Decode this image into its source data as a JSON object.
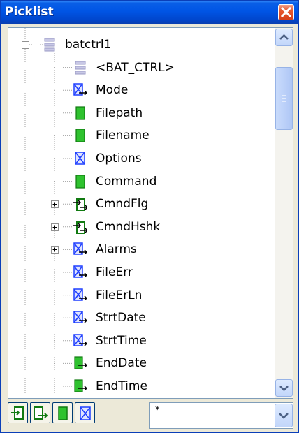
{
  "window": {
    "title": "Picklist"
  },
  "tree": {
    "items": [
      {
        "label": "batctrl1",
        "icon": "struct-icon",
        "expander": "minus"
      },
      {
        "label": "<BAT_CTRL>",
        "icon": "struct-icon",
        "expander": ""
      },
      {
        "label": "Mode",
        "icon": "blue-cross-arrow-icon",
        "expander": ""
      },
      {
        "label": "Filepath",
        "icon": "green-block-icon",
        "expander": ""
      },
      {
        "label": "Filename",
        "icon": "green-block-icon",
        "expander": ""
      },
      {
        "label": "Options",
        "icon": "blue-cross-icon",
        "expander": ""
      },
      {
        "label": "Command",
        "icon": "green-block-icon",
        "expander": ""
      },
      {
        "label": "CmndFlg",
        "icon": "green-double-arrow-icon",
        "expander": "plus"
      },
      {
        "label": "CmndHshk",
        "icon": "green-double-arrow-icon",
        "expander": "plus"
      },
      {
        "label": "Alarms",
        "icon": "blue-cross-arrow-icon",
        "expander": "plus"
      },
      {
        "label": "FileErr",
        "icon": "blue-cross-arrow-icon",
        "expander": ""
      },
      {
        "label": "FileErLn",
        "icon": "blue-cross-arrow-icon",
        "expander": ""
      },
      {
        "label": "StrtDate",
        "icon": "blue-cross-arrow-icon",
        "expander": ""
      },
      {
        "label": "StrtTime",
        "icon": "blue-cross-arrow-icon",
        "expander": ""
      },
      {
        "label": "EndDate",
        "icon": "green-block-arrow-icon",
        "expander": ""
      },
      {
        "label": "EndTime",
        "icon": "green-block-arrow-icon",
        "expander": ""
      }
    ]
  },
  "toolbar": {
    "buttons": [
      {
        "name": "import-tag-button",
        "icon": "arrow-into-box-icon"
      },
      {
        "name": "export-tag-button",
        "icon": "arrow-out-box-icon"
      },
      {
        "name": "green-block-filter-button",
        "icon": "green-block-icon"
      },
      {
        "name": "blue-cross-filter-button",
        "icon": "blue-cross-icon"
      }
    ],
    "filter_value": "*"
  },
  "colors": {
    "titlebar": "#0055e5",
    "tree_line": "#a0a0a0",
    "blue_icon": "#1f3fff",
    "green_icon": "#22b422"
  }
}
